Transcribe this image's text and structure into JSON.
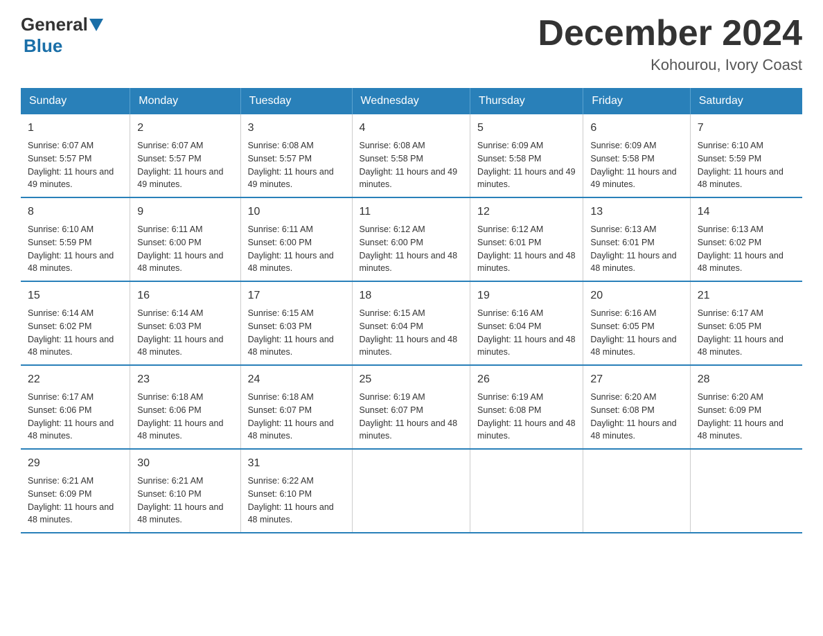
{
  "header": {
    "logo_general": "General",
    "logo_blue": "Blue",
    "month_title": "December 2024",
    "location": "Kohourou, Ivory Coast"
  },
  "weekdays": [
    "Sunday",
    "Monday",
    "Tuesday",
    "Wednesday",
    "Thursday",
    "Friday",
    "Saturday"
  ],
  "weeks": [
    [
      {
        "day": "1",
        "sunrise": "6:07 AM",
        "sunset": "5:57 PM",
        "daylight": "11 hours and 49 minutes."
      },
      {
        "day": "2",
        "sunrise": "6:07 AM",
        "sunset": "5:57 PM",
        "daylight": "11 hours and 49 minutes."
      },
      {
        "day": "3",
        "sunrise": "6:08 AM",
        "sunset": "5:57 PM",
        "daylight": "11 hours and 49 minutes."
      },
      {
        "day": "4",
        "sunrise": "6:08 AM",
        "sunset": "5:58 PM",
        "daylight": "11 hours and 49 minutes."
      },
      {
        "day": "5",
        "sunrise": "6:09 AM",
        "sunset": "5:58 PM",
        "daylight": "11 hours and 49 minutes."
      },
      {
        "day": "6",
        "sunrise": "6:09 AM",
        "sunset": "5:58 PM",
        "daylight": "11 hours and 49 minutes."
      },
      {
        "day": "7",
        "sunrise": "6:10 AM",
        "sunset": "5:59 PM",
        "daylight": "11 hours and 48 minutes."
      }
    ],
    [
      {
        "day": "8",
        "sunrise": "6:10 AM",
        "sunset": "5:59 PM",
        "daylight": "11 hours and 48 minutes."
      },
      {
        "day": "9",
        "sunrise": "6:11 AM",
        "sunset": "6:00 PM",
        "daylight": "11 hours and 48 minutes."
      },
      {
        "day": "10",
        "sunrise": "6:11 AM",
        "sunset": "6:00 PM",
        "daylight": "11 hours and 48 minutes."
      },
      {
        "day": "11",
        "sunrise": "6:12 AM",
        "sunset": "6:00 PM",
        "daylight": "11 hours and 48 minutes."
      },
      {
        "day": "12",
        "sunrise": "6:12 AM",
        "sunset": "6:01 PM",
        "daylight": "11 hours and 48 minutes."
      },
      {
        "day": "13",
        "sunrise": "6:13 AM",
        "sunset": "6:01 PM",
        "daylight": "11 hours and 48 minutes."
      },
      {
        "day": "14",
        "sunrise": "6:13 AM",
        "sunset": "6:02 PM",
        "daylight": "11 hours and 48 minutes."
      }
    ],
    [
      {
        "day": "15",
        "sunrise": "6:14 AM",
        "sunset": "6:02 PM",
        "daylight": "11 hours and 48 minutes."
      },
      {
        "day": "16",
        "sunrise": "6:14 AM",
        "sunset": "6:03 PM",
        "daylight": "11 hours and 48 minutes."
      },
      {
        "day": "17",
        "sunrise": "6:15 AM",
        "sunset": "6:03 PM",
        "daylight": "11 hours and 48 minutes."
      },
      {
        "day": "18",
        "sunrise": "6:15 AM",
        "sunset": "6:04 PM",
        "daylight": "11 hours and 48 minutes."
      },
      {
        "day": "19",
        "sunrise": "6:16 AM",
        "sunset": "6:04 PM",
        "daylight": "11 hours and 48 minutes."
      },
      {
        "day": "20",
        "sunrise": "6:16 AM",
        "sunset": "6:05 PM",
        "daylight": "11 hours and 48 minutes."
      },
      {
        "day": "21",
        "sunrise": "6:17 AM",
        "sunset": "6:05 PM",
        "daylight": "11 hours and 48 minutes."
      }
    ],
    [
      {
        "day": "22",
        "sunrise": "6:17 AM",
        "sunset": "6:06 PM",
        "daylight": "11 hours and 48 minutes."
      },
      {
        "day": "23",
        "sunrise": "6:18 AM",
        "sunset": "6:06 PM",
        "daylight": "11 hours and 48 minutes."
      },
      {
        "day": "24",
        "sunrise": "6:18 AM",
        "sunset": "6:07 PM",
        "daylight": "11 hours and 48 minutes."
      },
      {
        "day": "25",
        "sunrise": "6:19 AM",
        "sunset": "6:07 PM",
        "daylight": "11 hours and 48 minutes."
      },
      {
        "day": "26",
        "sunrise": "6:19 AM",
        "sunset": "6:08 PM",
        "daylight": "11 hours and 48 minutes."
      },
      {
        "day": "27",
        "sunrise": "6:20 AM",
        "sunset": "6:08 PM",
        "daylight": "11 hours and 48 minutes."
      },
      {
        "day": "28",
        "sunrise": "6:20 AM",
        "sunset": "6:09 PM",
        "daylight": "11 hours and 48 minutes."
      }
    ],
    [
      {
        "day": "29",
        "sunrise": "6:21 AM",
        "sunset": "6:09 PM",
        "daylight": "11 hours and 48 minutes."
      },
      {
        "day": "30",
        "sunrise": "6:21 AM",
        "sunset": "6:10 PM",
        "daylight": "11 hours and 48 minutes."
      },
      {
        "day": "31",
        "sunrise": "6:22 AM",
        "sunset": "6:10 PM",
        "daylight": "11 hours and 48 minutes."
      },
      null,
      null,
      null,
      null
    ]
  ],
  "labels": {
    "sunrise": "Sunrise:",
    "sunset": "Sunset:",
    "daylight": "Daylight:"
  }
}
